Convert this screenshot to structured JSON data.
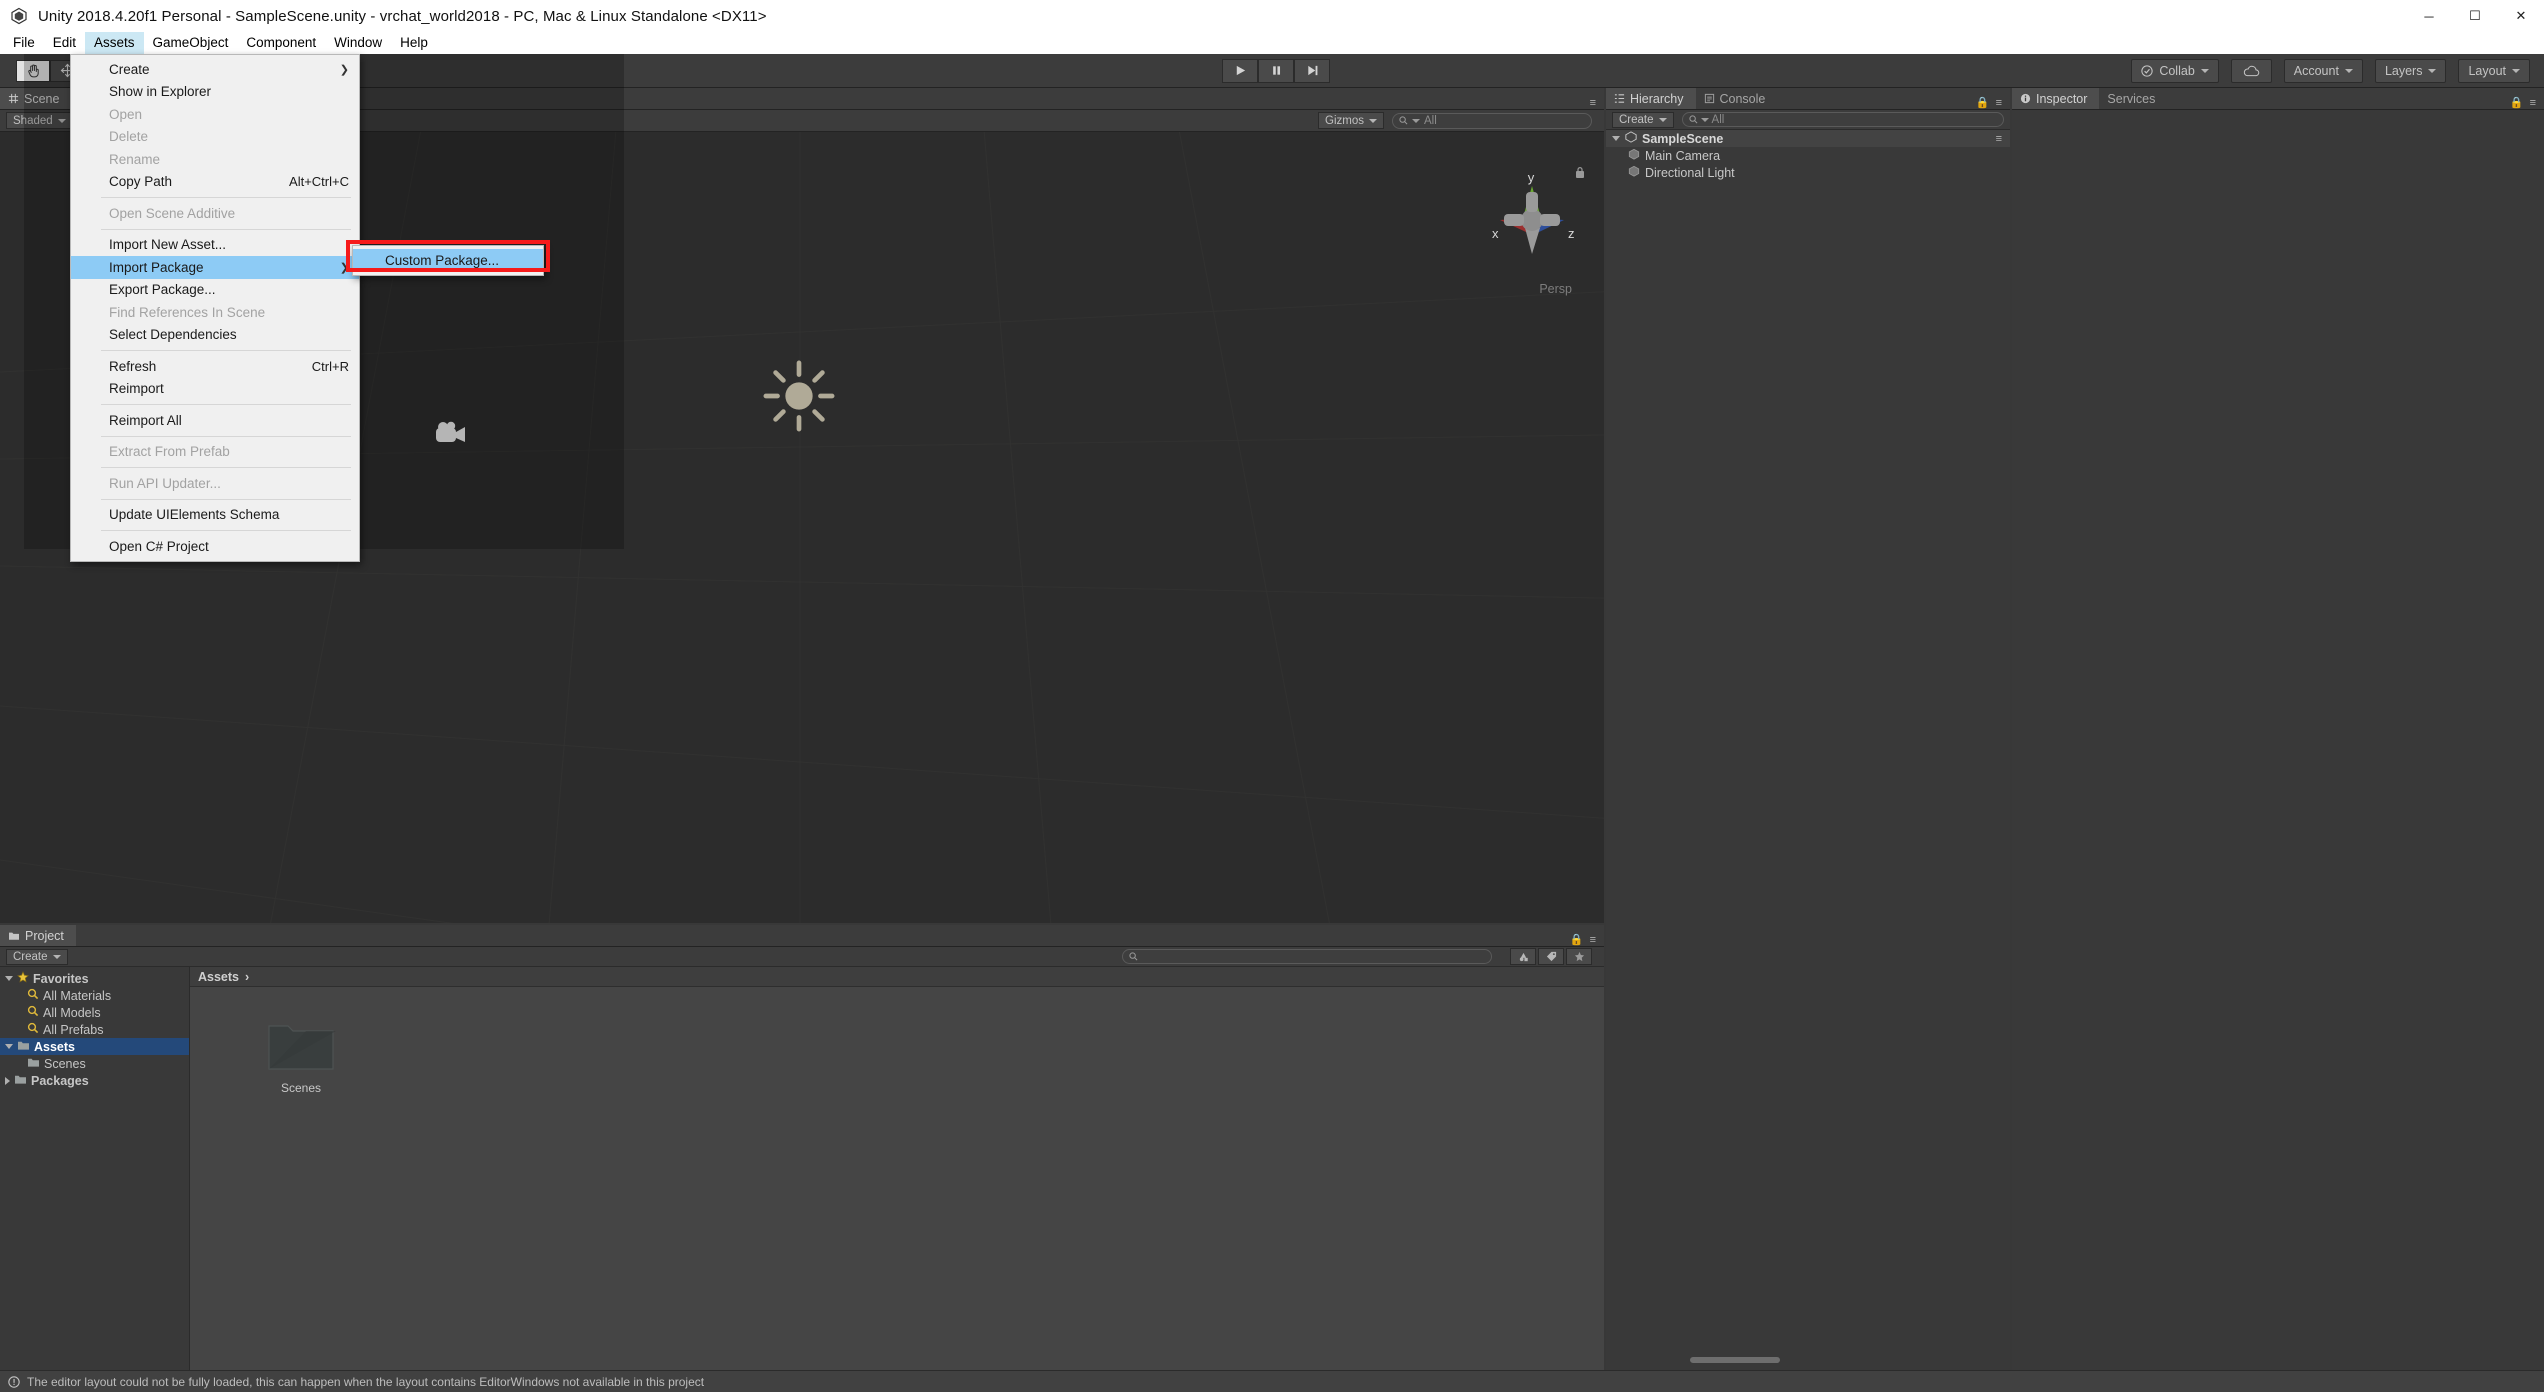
{
  "window": {
    "title": "Unity 2018.4.20f1 Personal - SampleScene.unity - vrchat_world2018 - PC, Mac & Linux Standalone <DX11>",
    "app_icon": "unity-icon",
    "minimize": "─",
    "maximize": "☐",
    "close": "✕"
  },
  "menubar": {
    "items": [
      {
        "label": "File",
        "active": false
      },
      {
        "label": "Edit",
        "active": false
      },
      {
        "label": "Assets",
        "active": true
      },
      {
        "label": "GameObject",
        "active": false
      },
      {
        "label": "Component",
        "active": false
      },
      {
        "label": "Window",
        "active": false
      },
      {
        "label": "Help",
        "active": false
      }
    ]
  },
  "assets_menu": {
    "items": [
      {
        "label": "Create",
        "shortcut": "",
        "disabled": false,
        "submenu": true,
        "highlight": false
      },
      {
        "label": "Show in Explorer",
        "shortcut": "",
        "disabled": false,
        "submenu": false,
        "highlight": false
      },
      {
        "label": "Open",
        "shortcut": "",
        "disabled": true,
        "submenu": false,
        "highlight": false
      },
      {
        "label": "Delete",
        "shortcut": "",
        "disabled": true,
        "submenu": false,
        "highlight": false
      },
      {
        "label": "Rename",
        "shortcut": "",
        "disabled": true,
        "submenu": false,
        "highlight": false
      },
      {
        "label": "Copy Path",
        "shortcut": "Alt+Ctrl+C",
        "disabled": false,
        "submenu": false,
        "highlight": false
      },
      {
        "separator": true
      },
      {
        "label": "Open Scene Additive",
        "shortcut": "",
        "disabled": true,
        "submenu": false,
        "highlight": false
      },
      {
        "separator": true
      },
      {
        "label": "Import New Asset...",
        "shortcut": "",
        "disabled": false,
        "submenu": false,
        "highlight": false
      },
      {
        "label": "Import Package",
        "shortcut": "",
        "disabled": false,
        "submenu": true,
        "highlight": true
      },
      {
        "label": "Export Package...",
        "shortcut": "",
        "disabled": false,
        "submenu": false,
        "highlight": false
      },
      {
        "label": "Find References In Scene",
        "shortcut": "",
        "disabled": true,
        "submenu": false,
        "highlight": false
      },
      {
        "label": "Select Dependencies",
        "shortcut": "",
        "disabled": false,
        "submenu": false,
        "highlight": false
      },
      {
        "separator": true
      },
      {
        "label": "Refresh",
        "shortcut": "Ctrl+R",
        "disabled": false,
        "submenu": false,
        "highlight": false
      },
      {
        "label": "Reimport",
        "shortcut": "",
        "disabled": false,
        "submenu": false,
        "highlight": false
      },
      {
        "separator": true
      },
      {
        "label": "Reimport All",
        "shortcut": "",
        "disabled": false,
        "submenu": false,
        "highlight": false
      },
      {
        "separator": true
      },
      {
        "label": "Extract From Prefab",
        "shortcut": "",
        "disabled": true,
        "submenu": false,
        "highlight": false
      },
      {
        "separator": true
      },
      {
        "label": "Run API Updater...",
        "shortcut": "",
        "disabled": true,
        "submenu": false,
        "highlight": false
      },
      {
        "separator": true
      },
      {
        "label": "Update UIElements Schema",
        "shortcut": "",
        "disabled": false,
        "submenu": false,
        "highlight": false
      },
      {
        "separator": true
      },
      {
        "label": "Open C# Project",
        "shortcut": "",
        "disabled": false,
        "submenu": false,
        "highlight": false
      }
    ]
  },
  "submenu": {
    "items": [
      {
        "label": "Custom Package...",
        "highlight": true
      }
    ],
    "annotation_color": "#f61a1a"
  },
  "toolbar": {
    "tools": [
      {
        "name": "hand-tool",
        "glyph": "✋",
        "selected": true
      },
      {
        "name": "move-tool",
        "glyph": "✥",
        "selected": false
      }
    ],
    "play": "▶",
    "pause": "‖",
    "step": "▶|",
    "collab_label": "Collab",
    "cloud_label": "",
    "account_label": "Account",
    "layers_label": "Layers",
    "layout_label": "Layout"
  },
  "scene": {
    "tabs": [
      {
        "label": "Scene",
        "active": true
      }
    ],
    "shading_mode": "Shaded",
    "gizmos_label": "Gizmos",
    "search_placeholder": "All",
    "axis": {
      "x": "x",
      "y": "y",
      "z": "z",
      "projection": "Persp"
    },
    "gizmo_objects": [
      "directional-light-gizmo",
      "main-camera-gizmo"
    ]
  },
  "hierarchy": {
    "tabs": [
      {
        "label": "Hierarchy",
        "active": true,
        "icon": "hierarchy-icon"
      },
      {
        "label": "Console",
        "active": false,
        "icon": "console-icon"
      }
    ],
    "create_label": "Create",
    "search_placeholder": "All",
    "tree": [
      {
        "label": "SampleScene",
        "depth": 0,
        "type": "scene",
        "expanded": true
      },
      {
        "label": "Main Camera",
        "depth": 1,
        "type": "gameobject"
      },
      {
        "label": "Directional Light",
        "depth": 1,
        "type": "gameobject"
      }
    ]
  },
  "inspector": {
    "tabs": [
      {
        "label": "Inspector",
        "active": true,
        "icon": "info-icon"
      },
      {
        "label": "Services",
        "active": false,
        "icon": ""
      }
    ]
  },
  "project": {
    "tabs": [
      {
        "label": "Project",
        "active": true,
        "icon": "folder-icon"
      }
    ],
    "create_label": "Create",
    "search_placeholder": "",
    "tree": [
      {
        "label": "Favorites",
        "depth": 0,
        "icon": "star-icon",
        "bold": true,
        "expanded": true,
        "selected": false
      },
      {
        "label": "All Materials",
        "depth": 1,
        "icon": "search-icon",
        "bold": false,
        "selected": false
      },
      {
        "label": "All Models",
        "depth": 1,
        "icon": "search-icon",
        "bold": false,
        "selected": false
      },
      {
        "label": "All Prefabs",
        "depth": 1,
        "icon": "search-icon",
        "bold": false,
        "selected": false
      },
      {
        "label": "Assets",
        "depth": 0,
        "icon": "folder-icon",
        "bold": true,
        "expanded": true,
        "selected": true
      },
      {
        "label": "Scenes",
        "depth": 1,
        "icon": "folder-icon",
        "bold": false,
        "selected": false
      },
      {
        "label": "Packages",
        "depth": 0,
        "icon": "folder-icon",
        "bold": true,
        "expanded": false,
        "selected": false
      }
    ],
    "breadcrumb": "Assets",
    "breadcrumb_sep": "›",
    "assets": [
      {
        "label": "Scenes",
        "icon": "folder-icon"
      }
    ]
  },
  "statusbar": {
    "icon": "warning-icon",
    "message": "The editor layout could not be fully loaded, this can happen when the layout contains EditorWindows not available in this project"
  }
}
